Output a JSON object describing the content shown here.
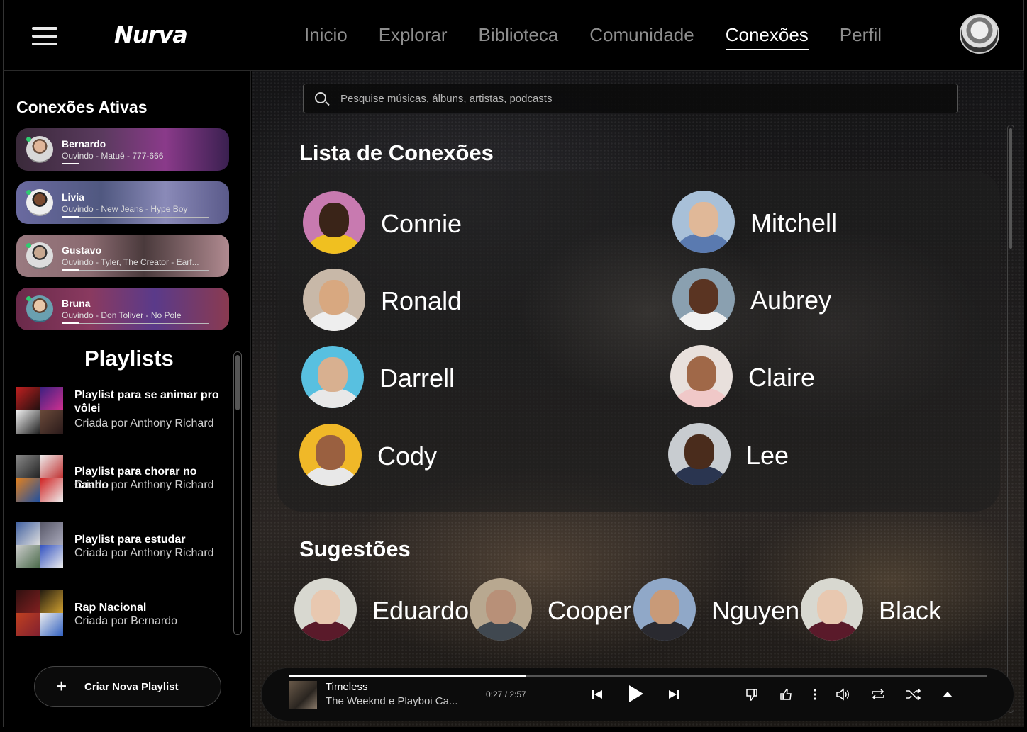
{
  "header": {
    "logo": "Nurva",
    "nav": [
      "Inicio",
      "Explorar",
      "Biblioteca",
      "Comunidade",
      "Conexões",
      "Perfil"
    ],
    "active_nav": "Conexões"
  },
  "sidebar": {
    "active_title": "Conexões Ativas",
    "active_connections": [
      {
        "name": "Bernardo",
        "status": "Ouvindo - Matuê - 777-666"
      },
      {
        "name": "Livia",
        "status": "Ouvindo - New Jeans - Hype Boy"
      },
      {
        "name": "Gustavo",
        "status": "Ouvindo - Tyler, The Creator - Earf..."
      },
      {
        "name": "Bruna",
        "status": "Ouvindo - Don Toliver - No Pole"
      }
    ],
    "playlists_title": "Playlists",
    "playlists": [
      {
        "name": "Playlist para se animar pro vôlei",
        "by": "Criada por Anthony Richard"
      },
      {
        "name": "Playlist para chorar no banho",
        "by": "Criada por Anthony Richard"
      },
      {
        "name": "Playlist para estudar",
        "by": "Criada por Anthony Richard"
      },
      {
        "name": "Rap Nacional",
        "by": "Criada por Bernardo"
      }
    ],
    "create_button": "Criar Nova Playlist"
  },
  "search": {
    "placeholder": "Pesquise músicas, álbuns, artistas, podcasts"
  },
  "connections": {
    "title": "Lista de Conexões",
    "people": [
      "Connie",
      "Mitchell",
      "Ronald",
      "Aubrey",
      "Darrell",
      "Claire",
      "Cody",
      "Lee"
    ]
  },
  "suggestions": {
    "title": "Sugestões",
    "people": [
      "Eduardo",
      "Cooper",
      "Nguyen",
      "Black"
    ]
  },
  "player": {
    "track": "Timeless",
    "artist": "The Weeknd e Playboi Ca...",
    "time": "0:27 / 2:57",
    "progress": 0.34
  },
  "colors": {
    "online": "#2ecc71",
    "active_nav": "#ffffff",
    "inactive_nav": "#8e8e8e"
  }
}
